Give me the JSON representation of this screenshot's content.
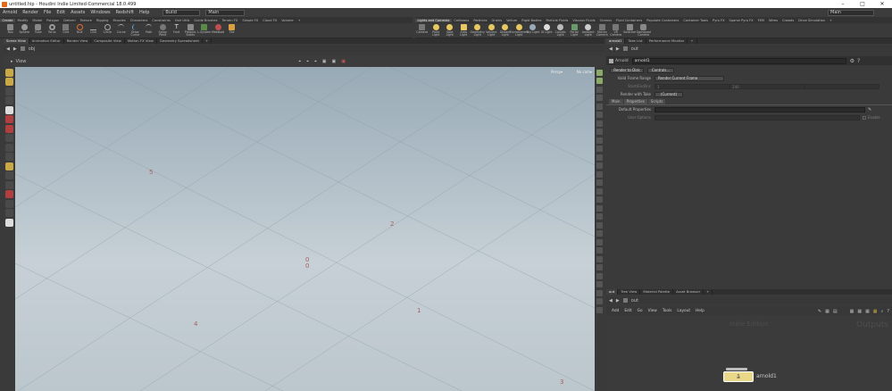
{
  "window": {
    "title": "untitled.hip - Houdini Indie Limited-Commercial 18.0.499",
    "min": "–",
    "max": "□",
    "close": "✕"
  },
  "menubar": {
    "items": [
      "Arnold",
      "Render",
      "File",
      "Edit",
      "Assets",
      "Windows",
      "Redshift",
      "Help"
    ],
    "desktop_left": "Build",
    "desktop_mid": "Main",
    "desktop_right": "Main"
  },
  "shelf_left": {
    "tabs": [
      "Create",
      "Modify",
      "Model",
      "Polygon",
      "Deform",
      "Texture",
      "Rigging",
      "Muscles",
      "Characters",
      "Constraints",
      "Hair Utils",
      "Guide Brushes",
      "Terrain FX",
      "Simple FX",
      "Cloud FX",
      "Volume"
    ],
    "tools": [
      "Box",
      "Sphere",
      "Tube",
      "Torus",
      "Grid",
      "Null",
      "Line",
      "Circle",
      "Curve",
      "Draw Curve",
      "Path",
      "Spray Paint",
      "Font",
      "Platonic Solids",
      "L-System",
      "Metaball",
      "File"
    ]
  },
  "shelf_right": {
    "tabs": [
      "Lights and Cameras",
      "Collisions",
      "Particles",
      "Grains",
      "Vellum",
      "Rigid Bodies",
      "Particle Fluids",
      "Viscous Fluids",
      "Oceans",
      "Fluid Containers",
      "Populate Containers",
      "Container Tools",
      "Pyro FX",
      "Sparse Pyro FX",
      "FEM",
      "Wires",
      "Crowds",
      "Drive Simulation"
    ],
    "tools": [
      "Camera",
      "Point Light",
      "Spot Light",
      "Area Light",
      "Geometry Light",
      "Volume Light",
      "Distant Light",
      "Environment Light",
      "Sky Light",
      "GI Light",
      "Caustic Light",
      "Portal Light",
      "Ambient Light",
      "Stereo Camera",
      "VR Camera",
      "Switcher",
      "Gamepad Camera"
    ]
  },
  "left_panes": {
    "tabs": [
      "Scene View",
      "Animation Editor",
      "Render View",
      "Composite View",
      "Motion FX View",
      "Geometry Spreadsheet"
    ],
    "path": "obj",
    "view_label": "View"
  },
  "viewport": {
    "camera": "Persp▾",
    "cam_mode": "No cam▾",
    "grid_labels": [
      "1",
      "2",
      "3",
      "4",
      "5",
      "0",
      "0"
    ]
  },
  "params": {
    "tabs": [
      "arnold1",
      "Take List",
      "Performance Monitor"
    ],
    "path": "out",
    "node_type": "Arnold",
    "node_name": "arnold1",
    "render_to_disk": "Render to Disk",
    "controls": "Controls...",
    "valid_frame_range_label": "Valid Frame Range",
    "valid_frame_range_value": "Render Current Frame",
    "start_end_label": "Start/End/Inc",
    "start_end_value": "1",
    "start_end_value2": "240",
    "render_with_take_label": "Render with Take",
    "render_with_take_value": "(Current)",
    "subtabs": [
      "Main",
      "Properties",
      "Scripts"
    ],
    "default_properties_label": "Default Properties",
    "user_options_label": "User Options",
    "enable_label": "Enable"
  },
  "network": {
    "tabs": [
      "out",
      "Tree View",
      "Material Palette",
      "Asset Browser"
    ],
    "path": "out",
    "menu": [
      "Add",
      "Edit",
      "Go",
      "View",
      "Tools",
      "Layout",
      "Help"
    ],
    "watermark_left": "Indie Edition",
    "watermark_right": "Outputs",
    "node_label": "arnold1"
  },
  "colors": {
    "accent": "#e06a1a",
    "node_yellow": "#e9d78a"
  }
}
